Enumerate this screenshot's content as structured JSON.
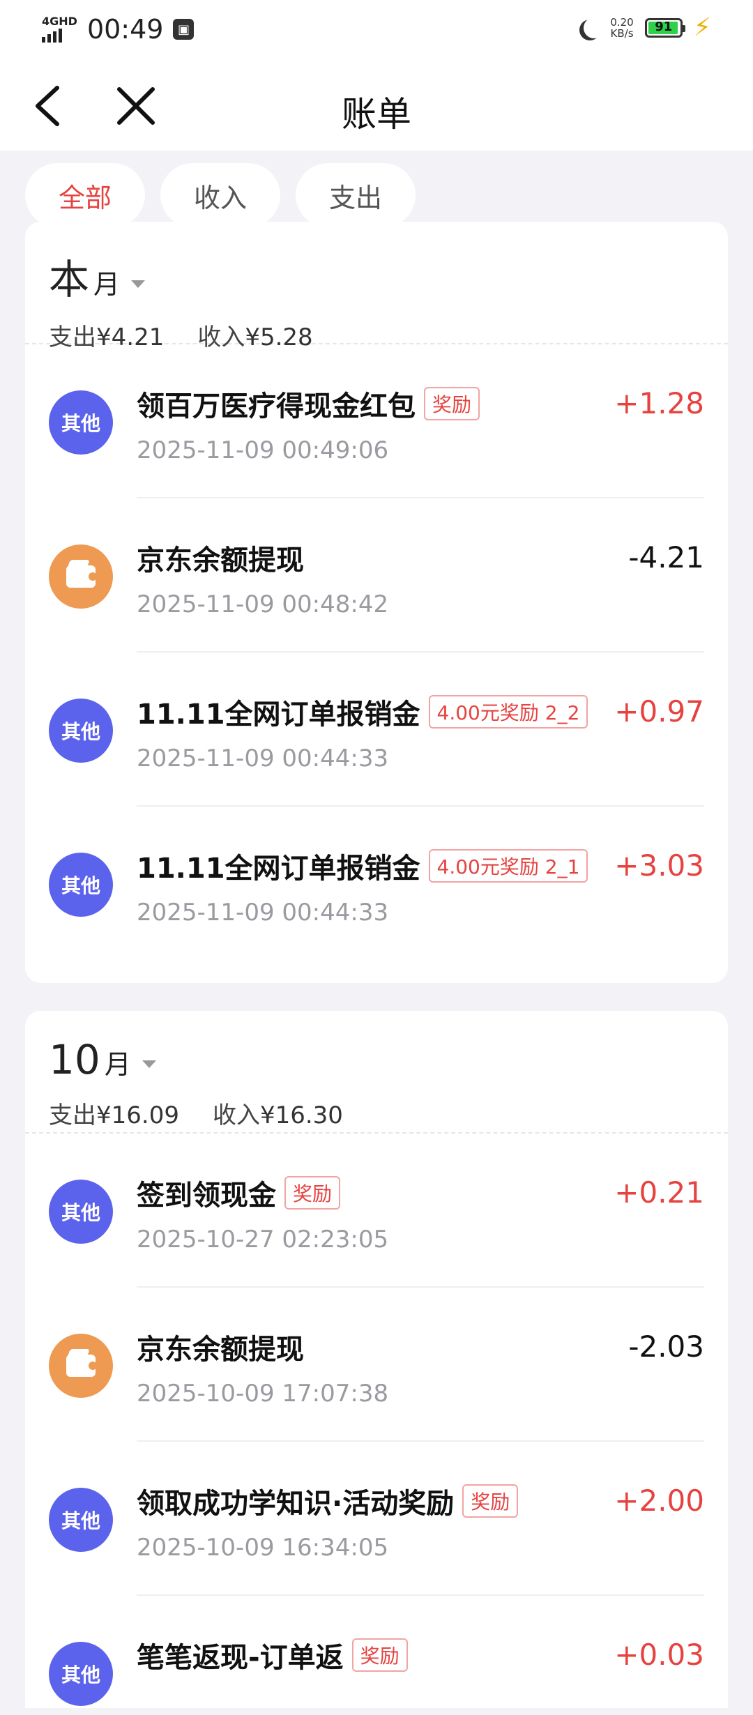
{
  "status_bar": {
    "network": "4GHD",
    "time": "00:49",
    "speed_value": "0.20",
    "speed_unit": "KB/s",
    "battery": "91"
  },
  "nav": {
    "title": "账单"
  },
  "filters": [
    {
      "label": "全部",
      "active": true
    },
    {
      "label": "收入",
      "active": false
    },
    {
      "label": "支出",
      "active": false
    }
  ],
  "months": [
    {
      "label_big": "本",
      "label_suffix": "月",
      "expense_label": "支出",
      "expense": "¥4.21",
      "income_label": "收入",
      "income": "¥5.28",
      "transactions": [
        {
          "icon": "other",
          "icon_text": "其他",
          "title": "领百万医疗得现金红包",
          "tag": "奖励",
          "date": "2025-11-09 00:49:06",
          "amount": "+1.28",
          "type": "income"
        },
        {
          "icon": "wallet",
          "icon_text": "",
          "title": "京东余额提现",
          "tag": "",
          "date": "2025-11-09 00:48:42",
          "amount": "-4.21",
          "type": "expense"
        },
        {
          "icon": "other",
          "icon_text": "其他",
          "title": "11.11全网订单报销金",
          "tag": "4.00元奖励 2_2",
          "date": "2025-11-09 00:44:33",
          "amount": "+0.97",
          "type": "income"
        },
        {
          "icon": "other",
          "icon_text": "其他",
          "title": "11.11全网订单报销金",
          "tag": "4.00元奖励 2_1",
          "date": "2025-11-09 00:44:33",
          "amount": "+3.03",
          "type": "income"
        }
      ]
    },
    {
      "label_big": "10",
      "label_suffix": "月",
      "expense_label": "支出",
      "expense": "¥16.09",
      "income_label": "收入",
      "income": "¥16.30",
      "transactions": [
        {
          "icon": "other",
          "icon_text": "其他",
          "title": "签到领现金",
          "tag": "奖励",
          "date": "2025-10-27 02:23:05",
          "amount": "+0.21",
          "type": "income"
        },
        {
          "icon": "wallet",
          "icon_text": "",
          "title": "京东余额提现",
          "tag": "",
          "date": "2025-10-09 17:07:38",
          "amount": "-2.03",
          "type": "expense"
        },
        {
          "icon": "other",
          "icon_text": "其他",
          "title": "领取成功学知识·活动奖励",
          "tag": "奖励",
          "date": "2025-10-09 16:34:05",
          "amount": "+2.00",
          "type": "income"
        },
        {
          "icon": "other",
          "icon_text": "其他",
          "title": "笔笔返现-订单返",
          "tag": "奖励",
          "date": "",
          "amount": "+0.03",
          "type": "income"
        }
      ]
    }
  ],
  "colors": {
    "accent": "#e64340",
    "other_icon": "#5b63ec",
    "wallet_icon": "#ee9a52",
    "background": "#f2f2f7"
  }
}
